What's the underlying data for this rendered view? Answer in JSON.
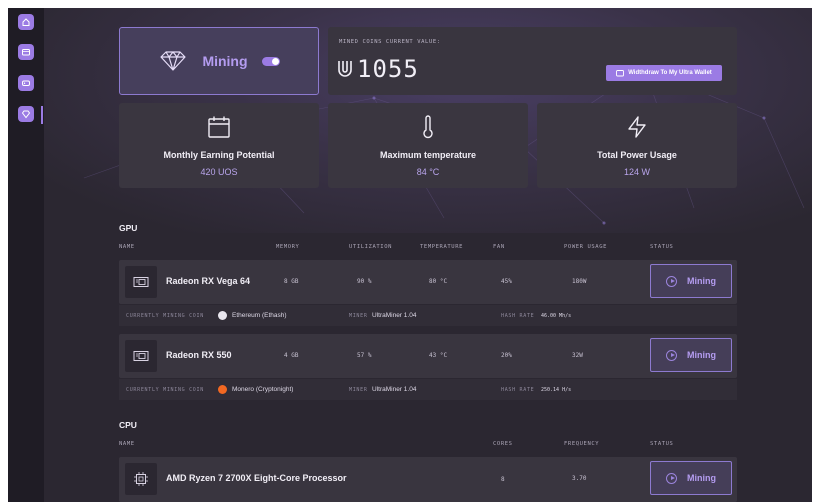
{
  "mining_toggle": {
    "label": "Mining"
  },
  "wallet": {
    "caption": "MINED COINS CURRENT VALUE:",
    "value": "1055",
    "withdraw_label": "Widthdraw To My Ultra Wallet"
  },
  "stats": [
    {
      "title": "Monthly Earning Potential",
      "value": "420 UOS",
      "icon": "calendar-icon"
    },
    {
      "title": "Maximum temperature",
      "value": "84 °C",
      "icon": "thermometer-icon"
    },
    {
      "title": "Total Power Usage",
      "value": "124 W",
      "icon": "lightning-icon"
    }
  ],
  "gpu": {
    "section_title": "GPU",
    "columns": [
      "NAME",
      "MEMORY",
      "UTILIZATION",
      "TEMPERATURE",
      "FAN",
      "POWER USAGE",
      "STATUS"
    ],
    "rows": [
      {
        "name": "Radeon RX Vega 64",
        "memory": "8 GB",
        "utilization": "90 %",
        "temperature": "80 °C",
        "fan": "45%",
        "power": "180W",
        "status": "Mining",
        "coin_label": "CURRENTLY MINING COIN",
        "coin": "Ethereum (Ethash)",
        "miner_label": "MINER",
        "miner": "UltraMiner 1.04",
        "hash_label": "HASH RATE",
        "hash": "46.00 Mh/s"
      },
      {
        "name": "Radeon RX 550",
        "memory": "4 GB",
        "utilization": "57 %",
        "temperature": "43 °C",
        "fan": "20%",
        "power": "32W",
        "status": "Mining",
        "coin_label": "CURRENTLY MINING COIN",
        "coin": "Monero (Cryptonight)",
        "miner_label": "MINER",
        "miner": "UltraMiner 1.04",
        "hash_label": "HASH RATE",
        "hash": "250.14 H/s"
      }
    ]
  },
  "cpu": {
    "section_title": "CPU",
    "columns": [
      "NAME",
      "CORES",
      "FREQUENCY",
      "STATUS"
    ],
    "rows": [
      {
        "name": "AMD Ryzen 7 2700X Eight-Core Processor",
        "cores": "8",
        "frequency": "3.70",
        "status": "Mining"
      }
    ]
  },
  "colors": {
    "accent": "#9b7be4",
    "background": "#2b2731",
    "card": "#39353f"
  }
}
